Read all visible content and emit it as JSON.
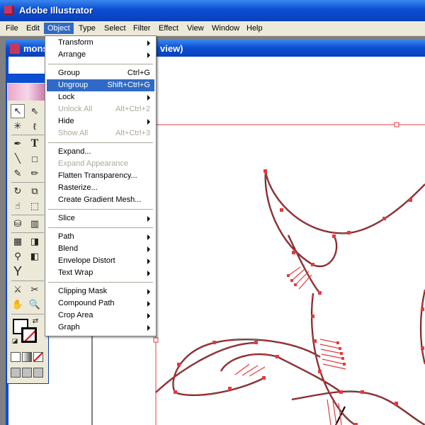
{
  "app": {
    "title": "Adobe Illustrator"
  },
  "menubar": {
    "items": [
      "File",
      "Edit",
      "Object",
      "Type",
      "Select",
      "Filter",
      "Effect",
      "View",
      "Window",
      "Help"
    ],
    "active": "Object"
  },
  "document": {
    "title_visible_start": "mons",
    "title_visible_end": "view)"
  },
  "object_menu": {
    "items": [
      {
        "label": "Transform",
        "shortcut": "",
        "submenu": true,
        "enabled": true,
        "highlighted": false
      },
      {
        "label": "Arrange",
        "shortcut": "",
        "submenu": true,
        "enabled": true,
        "highlighted": false
      },
      {
        "label": "Group",
        "shortcut": "Ctrl+G",
        "submenu": false,
        "enabled": true,
        "highlighted": false
      },
      {
        "label": "Ungroup",
        "shortcut": "Shift+Ctrl+G",
        "submenu": false,
        "enabled": true,
        "highlighted": true
      },
      {
        "label": "Lock",
        "shortcut": "",
        "submenu": true,
        "enabled": true,
        "highlighted": false
      },
      {
        "label": "Unlock All",
        "shortcut": "Alt+Ctrl+2",
        "submenu": false,
        "enabled": false,
        "highlighted": false
      },
      {
        "label": "Hide",
        "shortcut": "",
        "submenu": true,
        "enabled": true,
        "highlighted": false
      },
      {
        "label": "Show All",
        "shortcut": "Alt+Ctrl+3",
        "submenu": false,
        "enabled": false,
        "highlighted": false
      },
      {
        "label": "Expand...",
        "shortcut": "",
        "submenu": false,
        "enabled": true,
        "highlighted": false
      },
      {
        "label": "Expand Appearance",
        "shortcut": "",
        "submenu": false,
        "enabled": false,
        "highlighted": false
      },
      {
        "label": "Flatten Transparency...",
        "shortcut": "",
        "submenu": false,
        "enabled": true,
        "highlighted": false
      },
      {
        "label": "Rasterize...",
        "shortcut": "",
        "submenu": false,
        "enabled": true,
        "highlighted": false
      },
      {
        "label": "Create Gradient Mesh...",
        "shortcut": "",
        "submenu": false,
        "enabled": true,
        "highlighted": false
      },
      {
        "label": "Slice",
        "shortcut": "",
        "submenu": true,
        "enabled": true,
        "highlighted": false
      },
      {
        "label": "Path",
        "shortcut": "",
        "submenu": true,
        "enabled": true,
        "highlighted": false
      },
      {
        "label": "Blend",
        "shortcut": "",
        "submenu": true,
        "enabled": true,
        "highlighted": false
      },
      {
        "label": "Envelope Distort",
        "shortcut": "",
        "submenu": true,
        "enabled": true,
        "highlighted": false
      },
      {
        "label": "Text Wrap",
        "shortcut": "",
        "submenu": true,
        "enabled": true,
        "highlighted": false
      },
      {
        "label": "Clipping Mask",
        "shortcut": "",
        "submenu": true,
        "enabled": true,
        "highlighted": false
      },
      {
        "label": "Compound Path",
        "shortcut": "",
        "submenu": true,
        "enabled": true,
        "highlighted": false
      },
      {
        "label": "Crop Area",
        "shortcut": "",
        "submenu": true,
        "enabled": true,
        "highlighted": false
      },
      {
        "label": "Graph",
        "shortcut": "",
        "submenu": true,
        "enabled": true,
        "highlighted": false
      }
    ]
  },
  "tools": [
    "selection-tool",
    "direct-selection-tool",
    "magic-wand-tool",
    "lasso-tool",
    "pen-tool",
    "type-tool",
    "line-segment-tool",
    "rectangle-tool",
    "paintbrush-tool",
    "pencil-tool",
    "rotate-tool",
    "scale-tool",
    "warp-tool",
    "free-transform-tool",
    "symbol-sprayer-tool",
    "column-graph-tool",
    "mesh-tool",
    "gradient-tool",
    "eyedropper-tool",
    "blend-tool",
    "live-paint-bucket-tool",
    "slice-tool",
    "scissors-tool",
    "hand-tool",
    "zoom-tool"
  ],
  "colors": {
    "title_bar": "#0a4ed3",
    "menu_highlight": "#316ac5",
    "selection_path": "#e8393f",
    "palette_bg": "#ece9d8"
  }
}
